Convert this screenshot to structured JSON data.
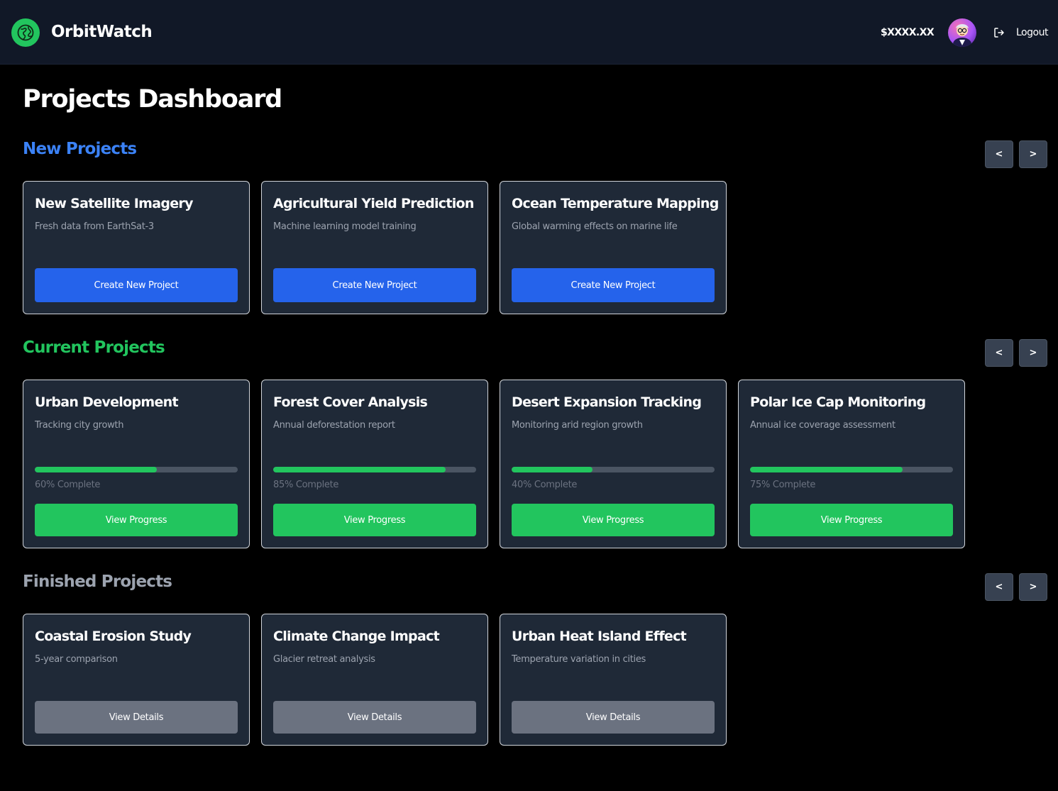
{
  "header": {
    "brand": "OrbitWatch",
    "balance": "$XXXX.XX",
    "logout_label": "Logout"
  },
  "page_title": "Projects Dashboard",
  "colors": {
    "new": "#3b82f6",
    "current": "#22c55e",
    "finished": "#9ca3af",
    "primary_button": "#2563eb",
    "success_button": "#22c55e",
    "neutral_button": "#6b7280"
  },
  "sections": {
    "new": {
      "title": "New Projects",
      "prev": "<",
      "next": ">",
      "cards": [
        {
          "title": "New Satellite Imagery",
          "desc": "Fresh data from EarthSat-3",
          "button": "Create New Project"
        },
        {
          "title": "Agricultural Yield Prediction",
          "desc": "Machine learning model training",
          "button": "Create New Project"
        },
        {
          "title": "Ocean Temperature Mapping",
          "desc": "Global warming effects on marine life",
          "button": "Create New Project"
        }
      ]
    },
    "current": {
      "title": "Current Projects",
      "prev": "<",
      "next": ">",
      "cards": [
        {
          "title": "Urban Development",
          "desc": "Tracking city growth",
          "progress": 60,
          "progress_label": "60% Complete",
          "button": "View Progress"
        },
        {
          "title": "Forest Cover Analysis",
          "desc": "Annual deforestation report",
          "progress": 85,
          "progress_label": "85% Complete",
          "button": "View Progress"
        },
        {
          "title": "Desert Expansion Tracking",
          "desc": "Monitoring arid region growth",
          "progress": 40,
          "progress_label": "40% Complete",
          "button": "View Progress"
        },
        {
          "title": "Polar Ice Cap Monitoring",
          "desc": "Annual ice coverage assessment",
          "progress": 75,
          "progress_label": "75% Complete",
          "button": "View Progress"
        }
      ]
    },
    "finished": {
      "title": "Finished Projects",
      "prev": "<",
      "next": ">",
      "cards": [
        {
          "title": "Coastal Erosion Study",
          "desc": "5-year comparison",
          "button": "View Details"
        },
        {
          "title": "Climate Change Impact",
          "desc": "Glacier retreat analysis",
          "button": "View Details"
        },
        {
          "title": "Urban Heat Island Effect",
          "desc": "Temperature variation in cities",
          "button": "View Details"
        }
      ]
    }
  }
}
